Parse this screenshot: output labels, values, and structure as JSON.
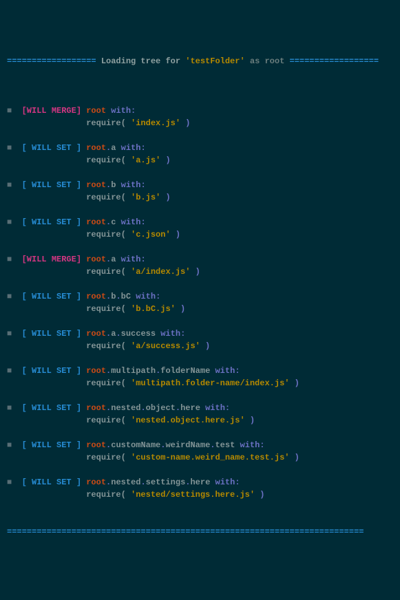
{
  "header": {
    "prefix_rule": "==================",
    "title_left": " Loading tree for ",
    "folder": "'testFolder'",
    "title_right": " as root ",
    "suffix_rule": "=================="
  },
  "footer_rule": "========================================================================",
  "bullet": "■",
  "tags": {
    "merge": "[WILL MERGE]",
    "set": "[ WILL SET ]"
  },
  "words": {
    "root": "root",
    "with": " with:",
    "require": "require( ",
    "close": " )",
    "dot": "."
  },
  "entries": [
    {
      "type": "merge",
      "path": [],
      "file": "'index.js'"
    },
    {
      "type": "set",
      "path": [
        "a"
      ],
      "file": "'a.js'"
    },
    {
      "type": "set",
      "path": [
        "b"
      ],
      "file": "'b.js'"
    },
    {
      "type": "set",
      "path": [
        "c"
      ],
      "file": "'c.json'"
    },
    {
      "type": "merge",
      "path": [
        "a"
      ],
      "file": "'a/index.js'"
    },
    {
      "type": "set",
      "path": [
        "b",
        "bC"
      ],
      "file": "'b.bC.js'"
    },
    {
      "type": "set",
      "path": [
        "a",
        "success"
      ],
      "file": "'a/success.js'"
    },
    {
      "type": "set",
      "path": [
        "multipath",
        "folderName"
      ],
      "file": "'multipath.folder-name/index.js'"
    },
    {
      "type": "set",
      "path": [
        "nested",
        "object",
        "here"
      ],
      "file": "'nested.object.here.js'"
    },
    {
      "type": "set",
      "path": [
        "customName",
        "weirdName",
        "test"
      ],
      "file": "'custom-name.weird_name.test.js'"
    },
    {
      "type": "set",
      "path": [
        "nested",
        "settings",
        "here"
      ],
      "file": "'nested/settings.here.js'"
    }
  ]
}
